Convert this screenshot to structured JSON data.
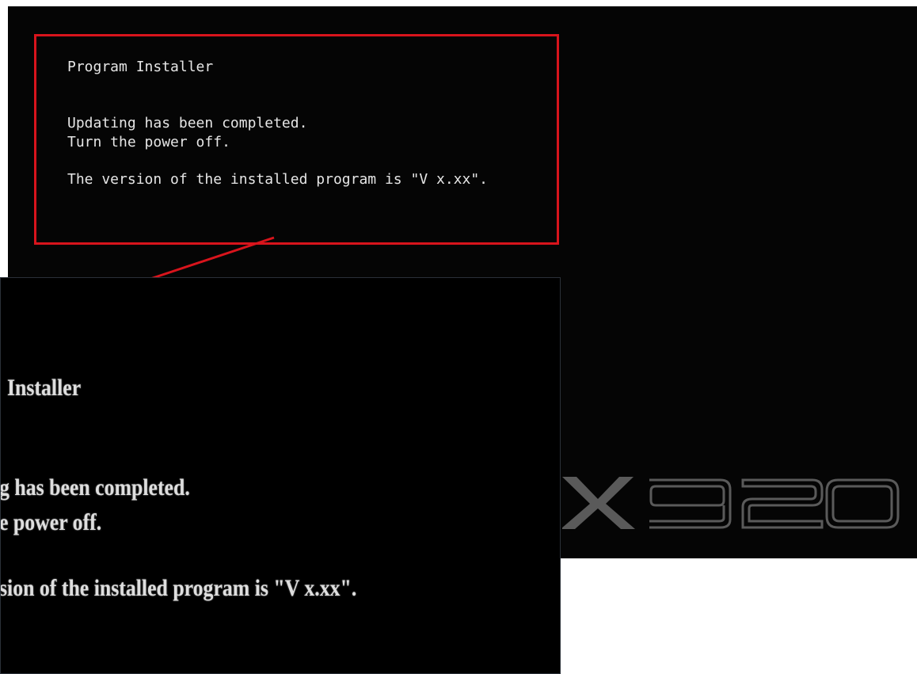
{
  "installer": {
    "title": "Program Installer",
    "line_completed": "Updating has been completed.",
    "line_power": "Turn the power off.",
    "line_version": "The version of the installed program is \"V x.xx\"."
  },
  "zoom": {
    "title_fragment": "Installer",
    "completed_fragment": "g has been completed.",
    "power_fragment": "e power off.",
    "version_fragment": "sion of the installed program is \"V x.xx\"."
  },
  "watermark": {
    "logo_text": "X920",
    "color": "#5a5a5a"
  },
  "colors": {
    "highlight": "#d8141c",
    "screen_bg": "#050505",
    "text": "#e6e6e6"
  }
}
